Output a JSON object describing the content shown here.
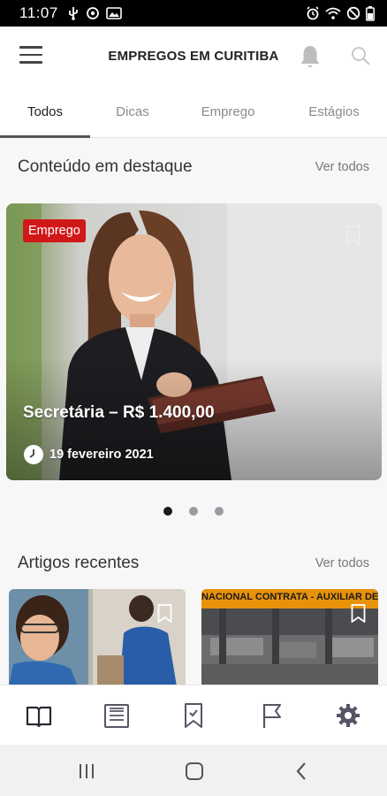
{
  "status_bar": {
    "time": "11:07"
  },
  "app_bar": {
    "title": "EMPREGOS EM CURITIBA"
  },
  "tabs": [
    {
      "label": "Todos",
      "active": true
    },
    {
      "label": "Dicas",
      "active": false
    },
    {
      "label": "Emprego",
      "active": false
    },
    {
      "label": "Estágios",
      "active": false
    }
  ],
  "featured": {
    "section_title": "Conteúdo em destaque",
    "see_all": "Ver todos",
    "card": {
      "category": "Emprego",
      "title": "Secretária – R$ 1.400,00",
      "date": "19 fevereiro 2021"
    },
    "carousel": {
      "pages": 3,
      "current": 1
    }
  },
  "recent": {
    "section_title": "Artigos recentes",
    "see_all": "Ver todos",
    "articles": [
      {
        "banner_text": ""
      },
      {
        "banner_text": "NACIONAL CONTRATA - AUXILIAR DE PROD"
      }
    ]
  },
  "bottom_nav": {
    "items": [
      "book-icon",
      "newspaper-icon",
      "bookmark-icon",
      "flag-icon",
      "gear-icon"
    ]
  },
  "colors": {
    "badge_red": "#d01818",
    "banner_orange": "#e8920a",
    "nav_icon": "#3a3a4a"
  }
}
